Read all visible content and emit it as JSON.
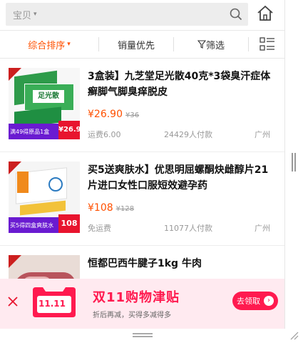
{
  "search": {
    "scope": "宝贝",
    "scope_caret": "▾"
  },
  "filters": {
    "sort": "综合排序",
    "sort_caret": "▾",
    "sales": "销量优先",
    "filter": "筛选"
  },
  "products": [
    {
      "title": "3盒装】九芝堂足光散40克*3袋臭汗症体癣脚气脚臭痒脱皮",
      "price": "¥26.90",
      "old_price": "¥36",
      "shipping": "运费6.00",
      "paid": "24429人付款",
      "location": "广州",
      "thumb_text": "足光散",
      "thumb_promo": "满49得原品1盒",
      "thumb_price": "¥26.9"
    },
    {
      "title": "买5送爽肤水】优思明屈螺酮炔雌醇片21片进口女性口服短效避孕药",
      "price": "¥108",
      "old_price": "¥128",
      "shipping": "免运费",
      "paid": "11077人付款",
      "location": "广州",
      "thumb_promo": "买5得四盒爽肤水",
      "thumb_price": "108"
    },
    {
      "title": "恒都巴西牛腱子1kg 牛肉",
      "price": "",
      "old_price": "",
      "shipping": "",
      "paid": "",
      "location": ""
    }
  ],
  "banner": {
    "badge": "11.11",
    "title": "双11购物津贴",
    "subtitle": "折后再减，买得多减得多",
    "button": "去领取"
  },
  "colors": {
    "accent": "#ff5000",
    "banner_red": "#ff1a4f"
  }
}
